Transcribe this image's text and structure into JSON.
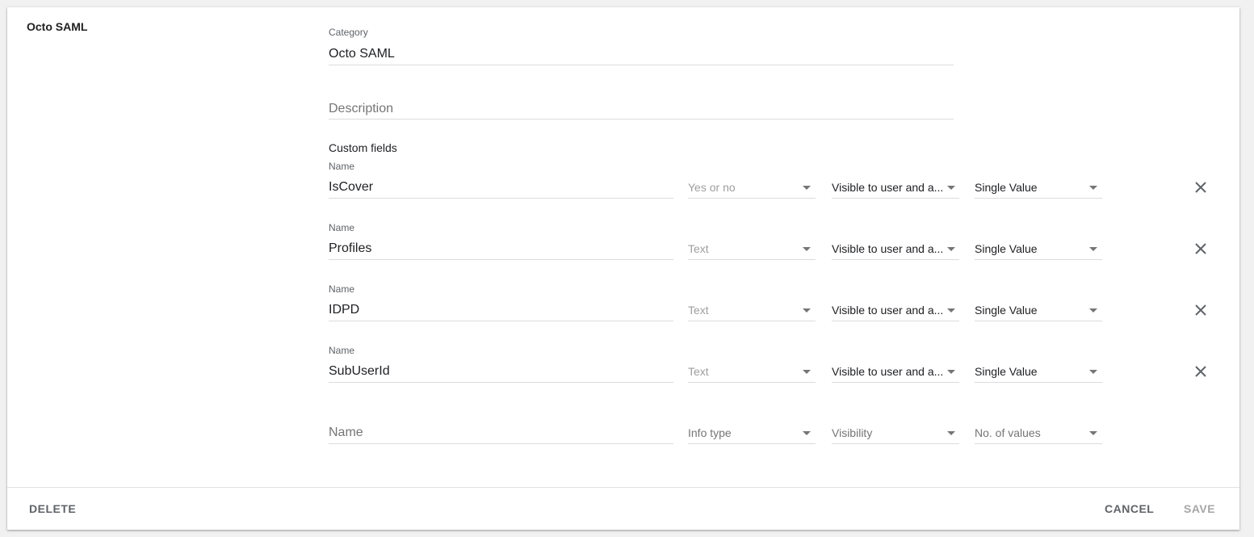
{
  "card": {
    "title": "Octo SAML"
  },
  "category": {
    "label": "Category",
    "value": "Octo SAML"
  },
  "description": {
    "placeholder": "Description"
  },
  "custom_fields": {
    "section_label": "Custom fields",
    "rows": [
      {
        "name_label": "Name",
        "name": "IsCover",
        "info_type": "Yes or no",
        "visibility": "Visible to user and a...",
        "values": "Single Value"
      },
      {
        "name_label": "Name",
        "name": "Profiles",
        "info_type": "Text",
        "visibility": "Visible to user and a...",
        "values": "Single Value"
      },
      {
        "name_label": "Name",
        "name": "IDPD",
        "info_type": "Text",
        "visibility": "Visible to user and a...",
        "values": "Single Value"
      },
      {
        "name_label": "Name",
        "name": "SubUserId",
        "info_type": "Text",
        "visibility": "Visible to user and a...",
        "values": "Single Value"
      }
    ],
    "new_row": {
      "name_placeholder": "Name",
      "info_type_placeholder": "Info type",
      "visibility_placeholder": "Visibility",
      "values_placeholder": "No. of values"
    }
  },
  "footer": {
    "delete_label": "DELETE",
    "cancel_label": "CANCEL",
    "save_label": "SAVE"
  },
  "icons": {
    "dropdown": "chevron-down-icon",
    "remove": "close-icon"
  }
}
